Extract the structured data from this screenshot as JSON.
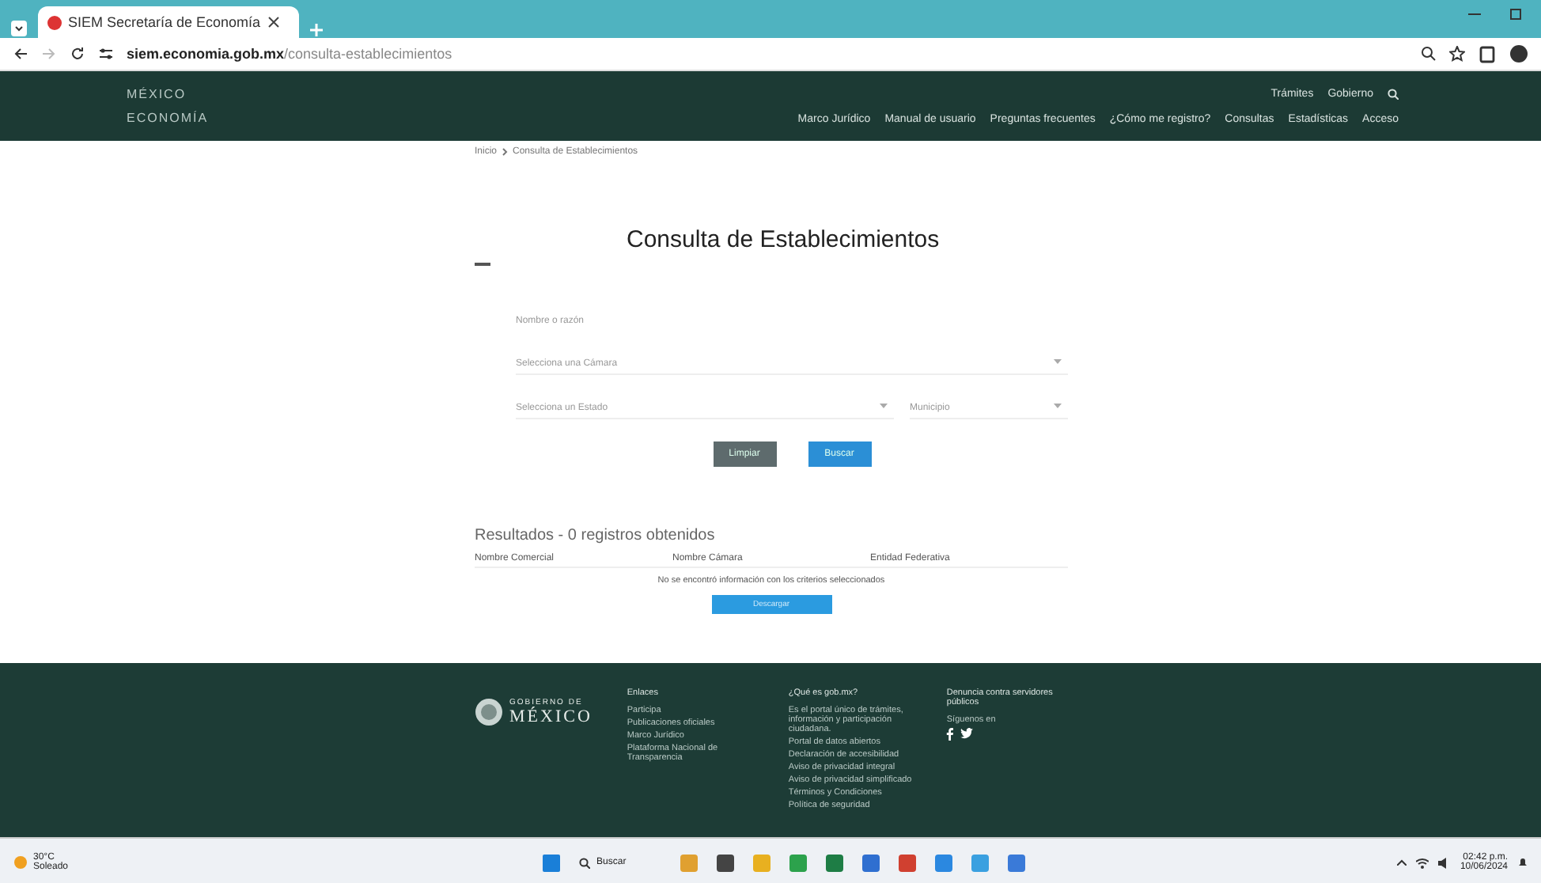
{
  "browser": {
    "tab_title": "SIEM Secretaría de Economía",
    "url_domain": "siem.economia.gob.mx",
    "url_path": "/consulta-establecimientos"
  },
  "header": {
    "logo": "MÉXICO",
    "subtitle": "ECONOMÍA",
    "top_links": [
      "Trámites",
      "Gobierno"
    ],
    "nav": [
      "Marco Jurídico",
      "Manual de usuario",
      "Preguntas frecuentes",
      "¿Cómo me registro?",
      "Consultas",
      "Estadísticas",
      "Acceso"
    ]
  },
  "breadcrumb": [
    "Inicio",
    "Consulta de Establecimientos"
  ],
  "title": "Consulta de Establecimientos",
  "form": {
    "name_placeholder": "Nombre o razón",
    "camara_placeholder": "Selecciona una Cámara",
    "estado_placeholder": "Selecciona un Estado",
    "municipio_placeholder": "Municipio",
    "buttons": [
      {
        "label": "Limpiar",
        "kind": "secondary"
      },
      {
        "label": "Buscar",
        "kind": "primary"
      }
    ]
  },
  "results": {
    "heading": "Resultados - 0 registros obtenidos",
    "columns": [
      "Nombre Comercial",
      "Nombre Cámara",
      "Entidad Federativa"
    ],
    "empty_message": "No se encontró información con los criterios seleccionados",
    "action_button": "Descargar"
  },
  "footer": {
    "logo_top": "GOBIERNO DE",
    "logo_bottom": "MÉXICO",
    "columns": [
      {
        "heading": "Enlaces",
        "links": [
          "Participa",
          "Publicaciones oficiales",
          "Marco Jurídico",
          "Plataforma Nacional de Transparencia"
        ]
      },
      {
        "heading": "¿Qué es gob.mx?",
        "links": [
          "Es el portal único de trámites, información y participación ciudadana.",
          "Portal de datos abiertos",
          "Declaración de accesibilidad",
          "Aviso de privacidad integral",
          "Aviso de privacidad simplificado",
          "Términos y Condiciones",
          "Política de seguridad"
        ]
      },
      {
        "heading": "Denuncia contra servidores públicos",
        "links": [
          "Síguenos en"
        ]
      }
    ]
  },
  "taskbar": {
    "temperature": "30°C",
    "weather": "Soleado",
    "search": "Buscar",
    "time": "02:42 p.m.",
    "date": "10/06/2024"
  }
}
